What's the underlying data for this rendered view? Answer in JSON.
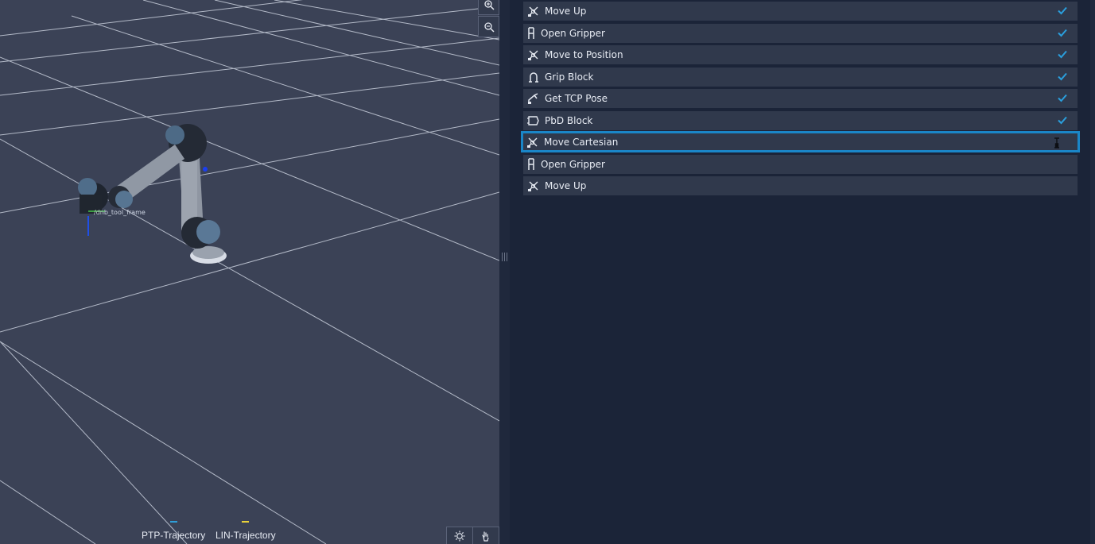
{
  "viewport": {
    "frame_label": "/dnb_tool_frame",
    "legend": [
      {
        "label": "PTP-Trajectory",
        "color": "#2f9ed8"
      },
      {
        "label": "LIN-Trajectory",
        "color": "#e9d23a"
      }
    ],
    "icons": {
      "zoom_in": "zoom-in-icon",
      "zoom_out": "zoom-out-icon",
      "lighting": "sun-icon",
      "pan": "hand-icon"
    }
  },
  "program": {
    "items": [
      {
        "label": "Move Up",
        "icon": "move-arm-icon",
        "done": true,
        "selected": false
      },
      {
        "label": "Open Gripper",
        "icon": "gripper-icon",
        "done": true,
        "selected": false
      },
      {
        "label": "Move to Position",
        "icon": "move-arm-icon",
        "done": true,
        "selected": false
      },
      {
        "label": "Grip Block",
        "icon": "grip-icon",
        "done": true,
        "selected": false
      },
      {
        "label": "Get TCP Pose",
        "icon": "tcp-pose-icon",
        "done": true,
        "selected": false
      },
      {
        "label": "PbD Block",
        "icon": "pbd-block-icon",
        "done": true,
        "selected": false
      },
      {
        "label": "Move Cartesian",
        "icon": "move-arm-icon",
        "done": false,
        "selected": true
      },
      {
        "label": "Open Gripper",
        "icon": "gripper-icon",
        "done": false,
        "selected": false
      },
      {
        "label": "Move Up",
        "icon": "move-arm-icon",
        "done": false,
        "selected": false
      }
    ]
  },
  "colors": {
    "selection": "#1a86c8",
    "check": "#2a9fdd",
    "row_bg": "#30394c",
    "panel_bg": "#1b2438",
    "viewport_bg": "#3b4256"
  }
}
